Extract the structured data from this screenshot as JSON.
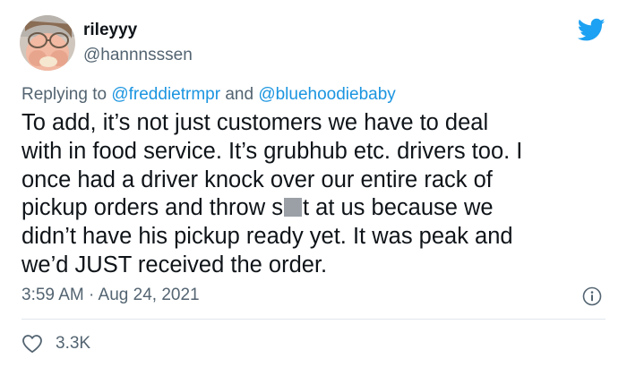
{
  "user": {
    "display_name": "rileyyy",
    "handle": "@hannnsssen",
    "avatar_icon": "profile-photo"
  },
  "reply": {
    "prefix": "Replying to",
    "mention_1": "@freddietrmpr",
    "joiner": "and",
    "mention_2": "@bluehoodiebaby"
  },
  "tweet": {
    "line_1": "To add, it’s not just customers we have to deal",
    "line_2": "with in food service. It’s grubhub etc. drivers too. I",
    "line_3": "once had a driver knock over our entire rack of",
    "line_4_before": "pickup orders and throw s",
    "line_4_after": "t at us because we",
    "line_5": "didn’t have his pickup ready yet. It was peak and",
    "line_6": "we’d JUST received the order."
  },
  "meta": {
    "timestamp": "3:59 AM · Aug 24, 2021"
  },
  "engagement": {
    "likes": "3.3K"
  },
  "icons": {
    "brand": "twitter-bird-icon",
    "info": "info-icon",
    "like": "heart-icon"
  },
  "colors": {
    "brand_blue": "#1da1f2",
    "mention_blue": "#1b95e0",
    "secondary_text": "#536471",
    "divider": "#e1e8ed"
  }
}
